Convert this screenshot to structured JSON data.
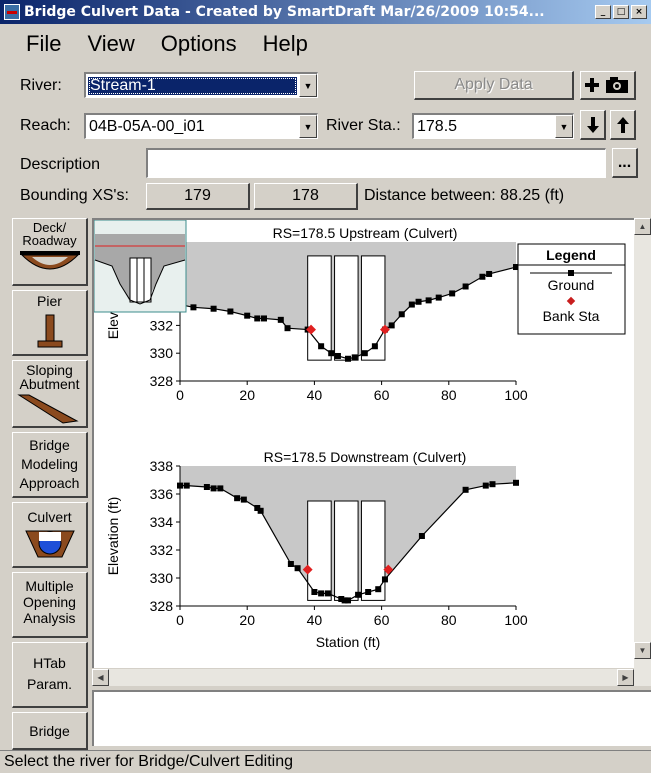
{
  "window": {
    "title": "Bridge Culvert Data - Created by SmartDraft Mar/26/2009 10:54..."
  },
  "title_buttons": {
    "minimize": "_",
    "maximize": "□",
    "close": "×"
  },
  "menu": [
    "File",
    "View",
    "Options",
    "Help"
  ],
  "river": {
    "label": "River:",
    "value": "Stream-1"
  },
  "apply_button": "Apply Data",
  "reach": {
    "label": "Reach:",
    "value": "04B-05A-00_i01"
  },
  "river_sta": {
    "label": "River Sta.:",
    "value": "178.5"
  },
  "description": {
    "label": "Description",
    "value": "",
    "browse": "..."
  },
  "bounding": {
    "label": "Bounding XS's:",
    "upstream": "179",
    "downstream": "178",
    "distance_text": "Distance between: 88.25 (ft)"
  },
  "tools": [
    {
      "label": "Deck/\nRoadway",
      "icon": "deck-roadway-icon"
    },
    {
      "label": "Pier",
      "icon": "pier-icon"
    },
    {
      "label": "Sloping\nAbutment",
      "icon": "sloping-abutment-icon"
    },
    {
      "label": "Bridge\nModeling\nApproach",
      "icon": null
    },
    {
      "label": "Culvert",
      "icon": "culvert-icon"
    },
    {
      "label": "Multiple\nOpening\nAnalysis",
      "icon": null
    },
    {
      "label": "HTab\nParam.",
      "icon": null
    },
    {
      "label": "Bridge",
      "icon": null
    }
  ],
  "status": "Select the river for Bridge/Culvert Editing",
  "colors": {
    "ground_fill": "#c8c8c8",
    "bank_station": "#e02020",
    "ground_line": "#000000"
  },
  "chart_data": [
    {
      "type": "line",
      "title": "RS=178.5   Upstream   (Culvert)",
      "ylabel": "Elevation (ft)",
      "xlim": [
        0,
        100
      ],
      "ylim": [
        328,
        338
      ],
      "xticks": [
        0,
        20,
        40,
        60,
        80,
        100
      ],
      "yticks": [
        328,
        330,
        332
      ],
      "series": [
        {
          "name": "Ground",
          "x": [
            0,
            4,
            10,
            15,
            20,
            23,
            25,
            30,
            32,
            38,
            42,
            45,
            47,
            50,
            52,
            55,
            58,
            61,
            63,
            66,
            69,
            71,
            74,
            77,
            81,
            85,
            90,
            92,
            100
          ],
          "y": [
            333.5,
            333.3,
            333.2,
            333.0,
            332.7,
            332.5,
            332.5,
            332.4,
            331.8,
            331.7,
            330.5,
            330.0,
            329.8,
            329.6,
            329.7,
            330.0,
            330.5,
            331.7,
            332.0,
            332.8,
            333.5,
            333.7,
            333.8,
            334.0,
            334.3,
            334.8,
            335.5,
            335.7,
            336.2
          ]
        },
        {
          "name": "Bank Sta",
          "x": [
            39,
            61
          ],
          "y": [
            331.7,
            331.7
          ]
        }
      ],
      "culvert_barrels": [
        {
          "x1": 38,
          "x2": 45,
          "y1": 329.5,
          "y2": 337.0
        },
        {
          "x1": 46,
          "x2": 53,
          "y1": 329.5,
          "y2": 337.0
        },
        {
          "x1": 54,
          "x2": 61,
          "y1": 329.5,
          "y2": 337.0
        }
      ],
      "legend": {
        "title": "Legend",
        "entries": [
          "Ground",
          "Bank Sta"
        ],
        "placement": "top-right"
      }
    },
    {
      "type": "line",
      "title": "RS=178.5   Downstream   (Culvert)",
      "xlabel": "Station (ft)",
      "ylabel": "Elevation (ft)",
      "xlim": [
        0,
        100
      ],
      "ylim": [
        328,
        338
      ],
      "xticks": [
        0,
        20,
        40,
        60,
        80,
        100
      ],
      "yticks": [
        328,
        330,
        332,
        334,
        336,
        338
      ],
      "series": [
        {
          "name": "Ground",
          "x": [
            0,
            2,
            8,
            10,
            12,
            17,
            19,
            23,
            24,
            33,
            35,
            40,
            42,
            44,
            48,
            49,
            50,
            53,
            56,
            59,
            61,
            72,
            85,
            91,
            93,
            100
          ],
          "y": [
            336.6,
            336.6,
            336.5,
            336.4,
            336.4,
            335.7,
            335.6,
            335.0,
            334.8,
            331.0,
            330.7,
            329.0,
            328.9,
            328.9,
            328.5,
            328.4,
            328.4,
            328.8,
            329.0,
            329.2,
            329.9,
            333.0,
            336.3,
            336.6,
            336.7,
            336.8
          ]
        },
        {
          "name": "Bank Sta",
          "x": [
            38,
            62
          ],
          "y": [
            330.6,
            330.6
          ]
        }
      ],
      "culvert_barrels": [
        {
          "x1": 38,
          "x2": 45,
          "y1": 328.4,
          "y2": 335.5
        },
        {
          "x1": 46,
          "x2": 53,
          "y1": 328.4,
          "y2": 335.5
        },
        {
          "x1": 54,
          "x2": 61,
          "y1": 328.4,
          "y2": 335.5
        }
      ]
    }
  ]
}
